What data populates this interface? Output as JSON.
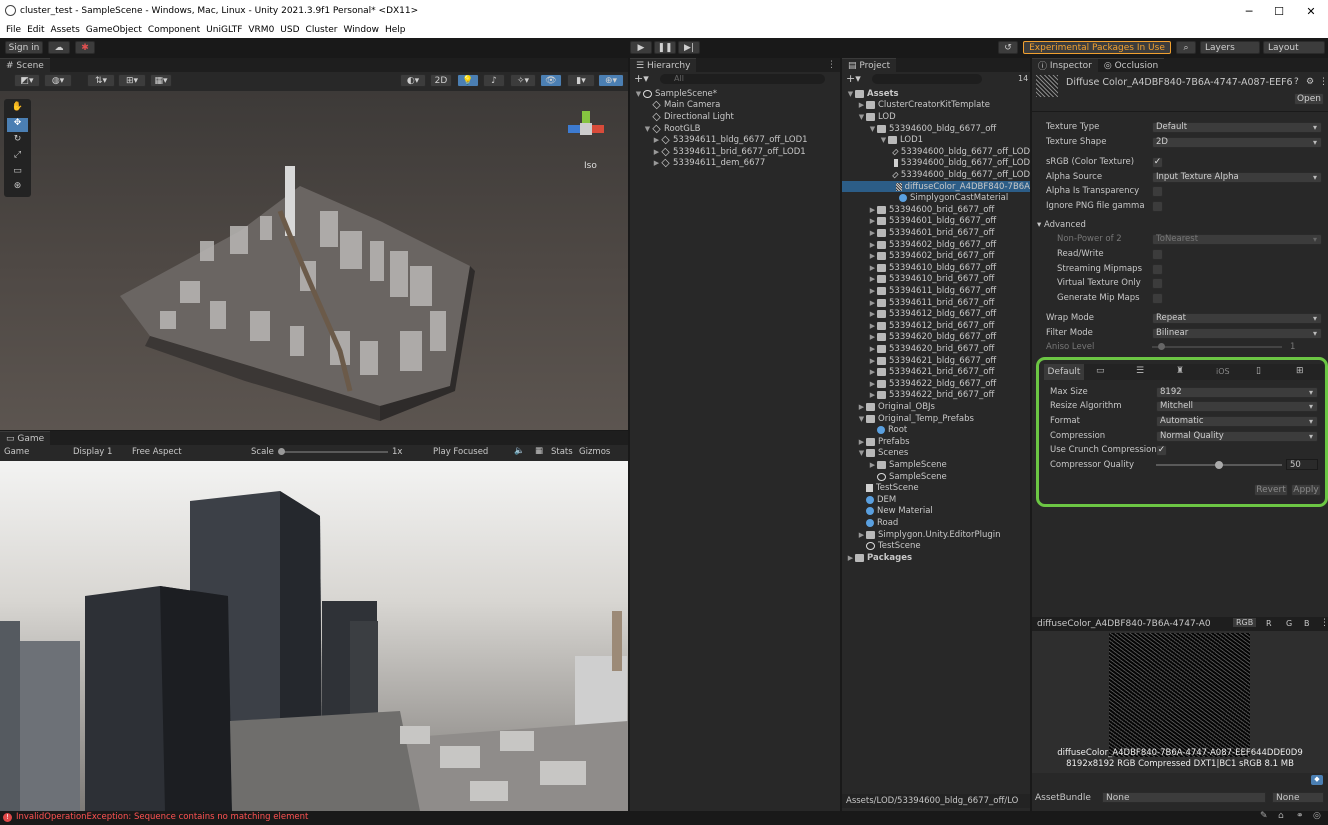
{
  "window": {
    "title": "cluster_test - SampleScene - Windows, Mac, Linux - Unity 2021.3.9f1 Personal* <DX11>"
  },
  "menu": [
    "File",
    "Edit",
    "Assets",
    "GameObject",
    "Component",
    "UniGLTF",
    "VRM0",
    "USD",
    "Cluster",
    "Window",
    "Help"
  ],
  "toolbar": {
    "sign_in": "Sign in",
    "experimental": "Experimental Packages In Use",
    "layers": "Layers",
    "layout": "Layout"
  },
  "scene": {
    "tab": "Scene",
    "btn_2d": "2D",
    "iso": "Iso"
  },
  "game": {
    "tab": "Game",
    "mode": "Game",
    "display": "Display 1",
    "aspect": "Free Aspect",
    "scale_label": "Scale",
    "scale_value": "1x",
    "play_mode": "Play Focused",
    "stats": "Stats",
    "gizmos": "Gizmos"
  },
  "hierarchy": {
    "tab": "Hierarchy",
    "search_placeholder": "All",
    "items": [
      {
        "label": "SampleScene*",
        "depth": 0,
        "icon": "unity",
        "fold": "open"
      },
      {
        "label": "Main Camera",
        "depth": 1,
        "icon": "cube",
        "fold": ""
      },
      {
        "label": "Directional Light",
        "depth": 1,
        "icon": "cube",
        "fold": ""
      },
      {
        "label": "RootGLB",
        "depth": 1,
        "icon": "cube",
        "fold": "open"
      },
      {
        "label": "53394611_bldg_6677_off_LOD1",
        "depth": 2,
        "icon": "cube",
        "fold": "closed"
      },
      {
        "label": "53394611_brid_6677_off_LOD1",
        "depth": 2,
        "icon": "cube",
        "fold": "closed"
      },
      {
        "label": "53394611_dem_6677",
        "depth": 2,
        "icon": "cube",
        "fold": "closed"
      }
    ]
  },
  "project": {
    "tab": "Project",
    "count": "14",
    "path": "Assets/LOD/53394600_bldg_6677_off/LO",
    "items": [
      {
        "label": "Assets",
        "depth": 0,
        "icon": "folder",
        "fold": "open",
        "bold": true
      },
      {
        "label": "ClusterCreatorKitTemplate",
        "depth": 1,
        "icon": "folder",
        "fold": "closed"
      },
      {
        "label": "LOD",
        "depth": 1,
        "icon": "folder",
        "fold": "open"
      },
      {
        "label": "53394600_bldg_6677_off",
        "depth": 2,
        "icon": "folder",
        "fold": "open"
      },
      {
        "label": "LOD1",
        "depth": 3,
        "icon": "folder",
        "fold": "open"
      },
      {
        "label": "53394600_bldg_6677_off_LOD",
        "depth": 4,
        "icon": "cube",
        "fold": ""
      },
      {
        "label": "53394600_bldg_6677_off_LOD",
        "depth": 4,
        "icon": "doc",
        "fold": ""
      },
      {
        "label": "53394600_bldg_6677_off_LOD",
        "depth": 4,
        "icon": "cube",
        "fold": ""
      },
      {
        "label": "diffuseColor_A4DBF840-7B6A",
        "depth": 4,
        "icon": "tex",
        "fold": "",
        "selected": true
      },
      {
        "label": "SimplygonCastMaterial",
        "depth": 4,
        "icon": "ball",
        "fold": ""
      },
      {
        "label": "53394600_brid_6677_off",
        "depth": 2,
        "icon": "folder",
        "fold": "closed"
      },
      {
        "label": "53394601_bldg_6677_off",
        "depth": 2,
        "icon": "folder",
        "fold": "closed"
      },
      {
        "label": "53394601_brid_6677_off",
        "depth": 2,
        "icon": "folder",
        "fold": "closed"
      },
      {
        "label": "53394602_bldg_6677_off",
        "depth": 2,
        "icon": "folder",
        "fold": "closed"
      },
      {
        "label": "53394602_brid_6677_off",
        "depth": 2,
        "icon": "folder",
        "fold": "closed"
      },
      {
        "label": "53394610_bldg_6677_off",
        "depth": 2,
        "icon": "folder",
        "fold": "closed"
      },
      {
        "label": "53394610_brid_6677_off",
        "depth": 2,
        "icon": "folder",
        "fold": "closed"
      },
      {
        "label": "53394611_bldg_6677_off",
        "depth": 2,
        "icon": "folder",
        "fold": "closed"
      },
      {
        "label": "53394611_brid_6677_off",
        "depth": 2,
        "icon": "folder",
        "fold": "closed"
      },
      {
        "label": "53394612_bldg_6677_off",
        "depth": 2,
        "icon": "folder",
        "fold": "closed"
      },
      {
        "label": "53394612_brid_6677_off",
        "depth": 2,
        "icon": "folder",
        "fold": "closed"
      },
      {
        "label": "53394620_bldg_6677_off",
        "depth": 2,
        "icon": "folder",
        "fold": "closed"
      },
      {
        "label": "53394620_brid_6677_off",
        "depth": 2,
        "icon": "folder",
        "fold": "closed"
      },
      {
        "label": "53394621_bldg_6677_off",
        "depth": 2,
        "icon": "folder",
        "fold": "closed"
      },
      {
        "label": "53394621_brid_6677_off",
        "depth": 2,
        "icon": "folder",
        "fold": "closed"
      },
      {
        "label": "53394622_bldg_6677_off",
        "depth": 2,
        "icon": "folder",
        "fold": "closed"
      },
      {
        "label": "53394622_brid_6677_off",
        "depth": 2,
        "icon": "folder",
        "fold": "closed"
      },
      {
        "label": "Original_OBJs",
        "depth": 1,
        "icon": "folder",
        "fold": "closed"
      },
      {
        "label": "Original_Temp_Prefabs",
        "depth": 1,
        "icon": "folder",
        "fold": "open"
      },
      {
        "label": "Root",
        "depth": 2,
        "icon": "ball",
        "fold": ""
      },
      {
        "label": "Prefabs",
        "depth": 1,
        "icon": "folder",
        "fold": "closed"
      },
      {
        "label": "Scenes",
        "depth": 1,
        "icon": "folder",
        "fold": "open"
      },
      {
        "label": "SampleScene",
        "depth": 2,
        "icon": "folder",
        "fold": "closed"
      },
      {
        "label": "SampleScene",
        "depth": 2,
        "icon": "unity",
        "fold": ""
      },
      {
        "label": "TestScene",
        "depth": 1,
        "icon": "doc",
        "fold": ""
      },
      {
        "label": "DEM",
        "depth": 1,
        "icon": "ball",
        "fold": ""
      },
      {
        "label": "New Material",
        "depth": 1,
        "icon": "ball",
        "fold": ""
      },
      {
        "label": "Road",
        "depth": 1,
        "icon": "ball",
        "fold": ""
      },
      {
        "label": "Simplygon.Unity.EditorPlugin",
        "depth": 1,
        "icon": "folder",
        "fold": "closed"
      },
      {
        "label": "TestScene",
        "depth": 1,
        "icon": "unity",
        "fold": ""
      },
      {
        "label": "Packages",
        "depth": 0,
        "icon": "folder",
        "fold": "closed",
        "bold": true
      }
    ]
  },
  "inspector": {
    "tab": "Inspector",
    "tab2": "Occlusion",
    "asset_name": "Diffuse Color_A4DBF840-7B6A-4747-A087-EEF6",
    "open_btn": "Open",
    "texture_type": {
      "label": "Texture Type",
      "value": "Default"
    },
    "texture_shape": {
      "label": "Texture Shape",
      "value": "2D"
    },
    "srgb": {
      "label": "sRGB (Color Texture)",
      "checked": "✓"
    },
    "alpha_source": {
      "label": "Alpha Source",
      "value": "Input Texture Alpha"
    },
    "alpha_transparency": {
      "label": "Alpha Is Transparency",
      "checked": ""
    },
    "ignore_png": {
      "label": "Ignore PNG file gamma",
      "checked": ""
    },
    "advanced": "Advanced",
    "non_power": {
      "label": "Non-Power of 2",
      "value": "ToNearest"
    },
    "read_write": {
      "label": "Read/Write",
      "checked": ""
    },
    "streaming": {
      "label": "Streaming Mipmaps",
      "checked": ""
    },
    "virtual": {
      "label": "Virtual Texture Only",
      "checked": ""
    },
    "gen_mip": {
      "label": "Generate Mip Maps",
      "checked": ""
    },
    "wrap_mode": {
      "label": "Wrap Mode",
      "value": "Repeat"
    },
    "filter_mode": {
      "label": "Filter Mode",
      "value": "Bilinear"
    },
    "aniso": {
      "label": "Aniso Level",
      "value": "1"
    },
    "platform": {
      "default_tab": "Default",
      "ios": "iOS",
      "max_size": {
        "label": "Max Size",
        "value": "8192"
      },
      "resize": {
        "label": "Resize Algorithm",
        "value": "Mitchell"
      },
      "format": {
        "label": "Format",
        "value": "Automatic"
      },
      "compression": {
        "label": "Compression",
        "value": "Normal Quality"
      },
      "crunch": {
        "label": "Use Crunch Compression",
        "checked": "✓"
      },
      "quality": {
        "label": "Compressor Quality",
        "value": "50",
        "fraction": 0.5
      },
      "revert": "Revert",
      "apply": "Apply"
    },
    "preview": {
      "title": "diffuseColor_A4DBF840-7B6A-4747-A0",
      "channels": [
        "RGB",
        "R",
        "G",
        "B"
      ],
      "caption1": "diffuseColor_A4DBF840-7B6A-4747-A087-EEF644DDE0D9",
      "caption2": "8192x8192  RGB Compressed DXT1|BC1 sRGB  8.1 MB"
    },
    "assetbundle": {
      "label": "AssetBundle",
      "value": "None",
      "variant": "None"
    }
  },
  "status": {
    "message": "InvalidOperationException: Sequence contains no matching element"
  },
  "colors": {
    "highlight": "#6cc644",
    "error": "#ff5252",
    "experimental": "#f0a030",
    "selected": "#2c5d87"
  }
}
